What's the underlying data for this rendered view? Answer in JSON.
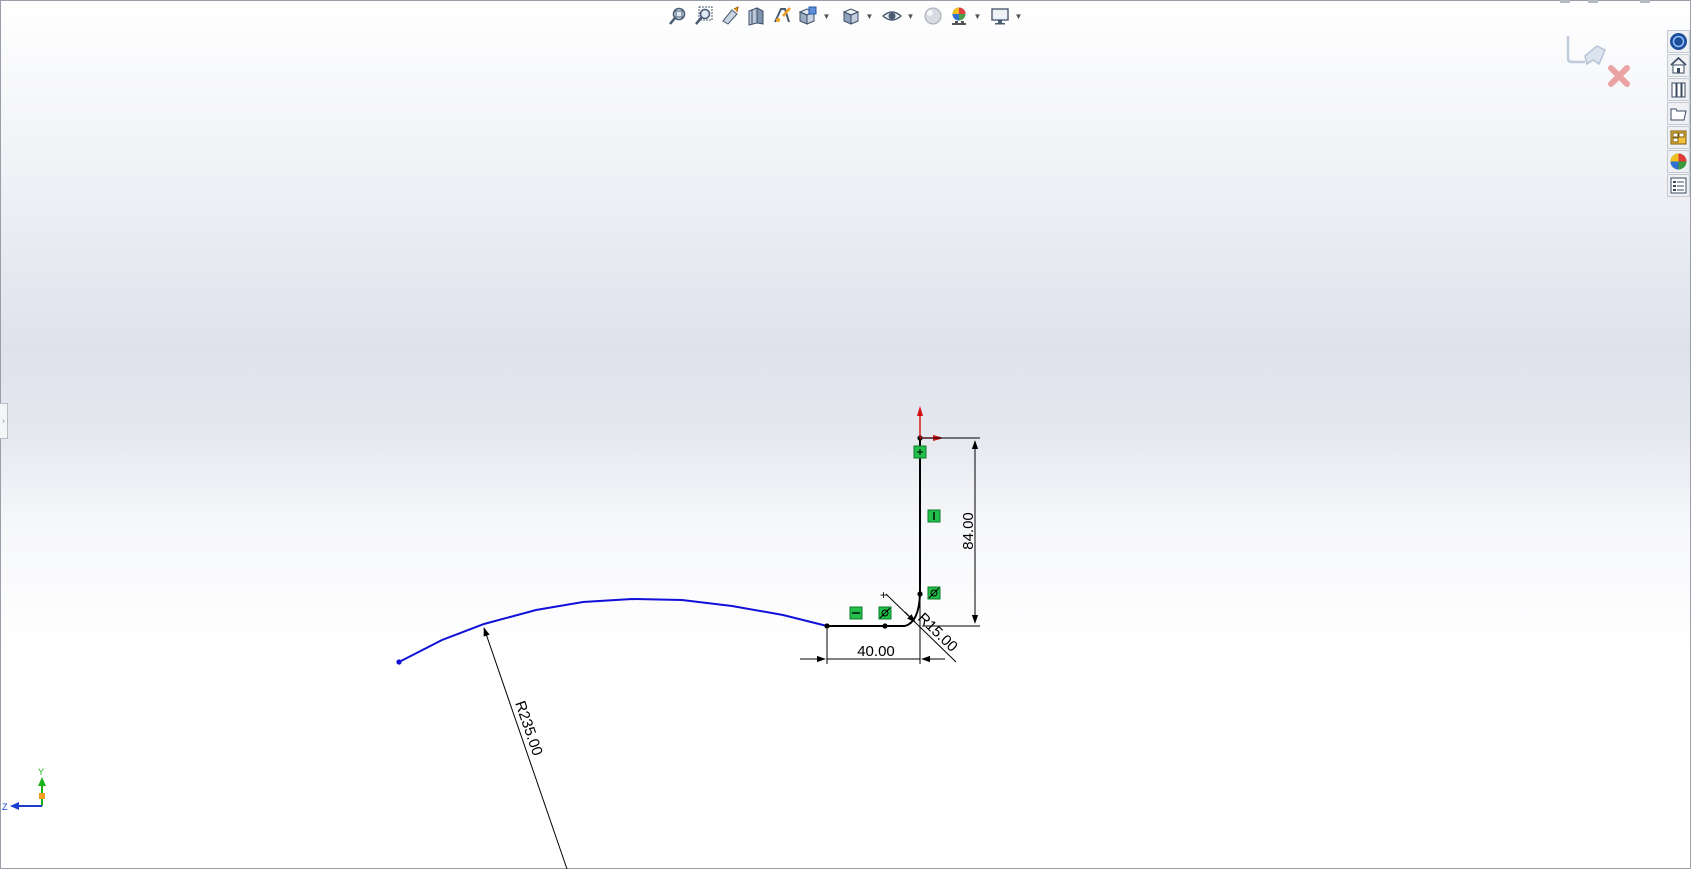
{
  "toolbar": {
    "buttons": [
      {
        "name": "zoom-to-fit-icon",
        "dropdown": false
      },
      {
        "name": "zoom-to-area-icon",
        "dropdown": false
      },
      {
        "name": "previous-view-icon",
        "dropdown": false
      },
      {
        "name": "section-view-icon",
        "dropdown": false
      },
      {
        "name": "dynamic-annotation-views-icon",
        "dropdown": false
      },
      {
        "name": "view-orientation-icon",
        "dropdown": true
      },
      {
        "name": "display-style-icon",
        "dropdown": true
      },
      {
        "name": "hide-show-items-icon",
        "dropdown": true
      },
      {
        "name": "edit-appearance-icon",
        "dropdown": false
      },
      {
        "name": "apply-scene-icon",
        "dropdown": true
      },
      {
        "name": "view-settings-icon",
        "dropdown": true
      }
    ]
  },
  "taskpane": {
    "items": [
      "solidworks-resources-icon",
      "home-icon",
      "design-library-icon",
      "file-explorer-icon",
      "view-palette-icon",
      "appearances-scenes-icon",
      "custom-properties-icon"
    ]
  },
  "sketch": {
    "dimensions": {
      "vertical": "84.00",
      "horizontal": "40.00",
      "fillet_radius": "R15.00",
      "arc_radius": "R235.00"
    },
    "colors": {
      "defined": "#000000",
      "underdefined": "#1010d8",
      "relation": "#22c04a",
      "origin": "#d01010"
    }
  },
  "triad": {
    "y_label": "Y",
    "z_label": "Z"
  }
}
